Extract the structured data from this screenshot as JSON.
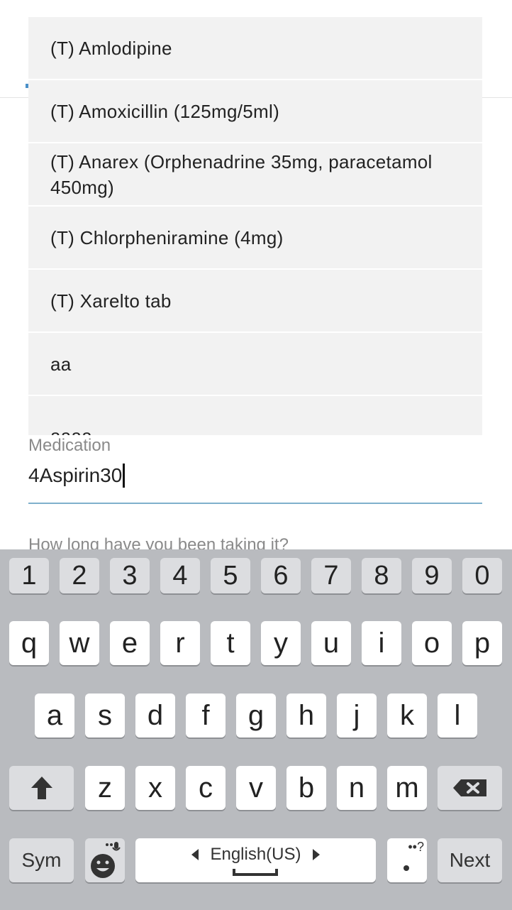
{
  "autocomplete": {
    "items": [
      {
        "label": "(T) Amlodipine"
      },
      {
        "label": "(T) Amoxicillin (125mg/5ml)"
      },
      {
        "label": "(T) Anarex (Orphenadrine 35mg, paracetamol 450mg)"
      },
      {
        "label": "(T) Chlorpheniramine (4mg)"
      },
      {
        "label": "(T) Xarelto tab"
      },
      {
        "label": "aa"
      },
      {
        "label": "aaaa"
      }
    ]
  },
  "medication": {
    "label": "Medication",
    "value": "4Aspirin30"
  },
  "next_question": "How long have you been taking it?",
  "keyboard": {
    "numbers": [
      "1",
      "2",
      "3",
      "4",
      "5",
      "6",
      "7",
      "8",
      "9",
      "0"
    ],
    "row1": [
      "q",
      "w",
      "e",
      "r",
      "t",
      "y",
      "u",
      "i",
      "o",
      "p"
    ],
    "row2": [
      "a",
      "s",
      "d",
      "f",
      "g",
      "h",
      "j",
      "k",
      "l"
    ],
    "row3": [
      "z",
      "x",
      "c",
      "v",
      "b",
      "n",
      "m"
    ],
    "sym_label": "Sym",
    "language_label": "English(US)",
    "punct_hint": "••?",
    "next_label": "Next",
    "icons": {
      "shift": "shift-arrow-icon",
      "backspace": "backspace-icon",
      "emoji": "emoji-mic-icon"
    }
  },
  "colors": {
    "keyboard_bg": "#b9bbbf",
    "dropdown_bg": "#f2f2f2",
    "field_underline": "#7fb0cc"
  }
}
